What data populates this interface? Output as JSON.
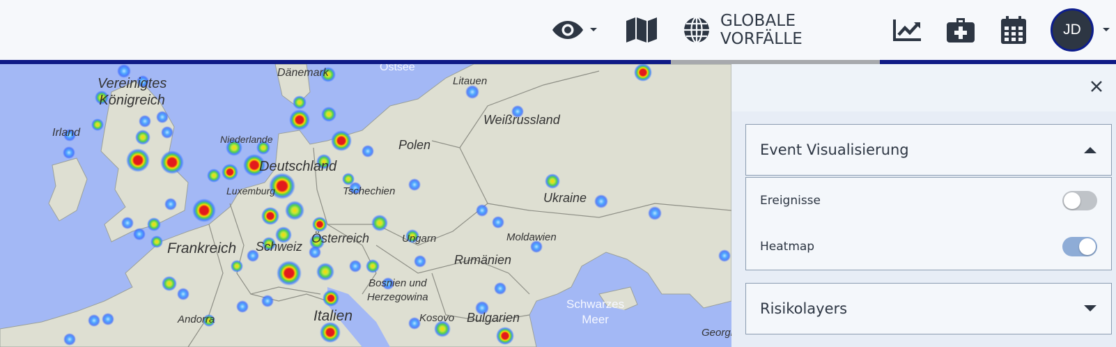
{
  "header": {
    "visibility_icon": "eye-icon",
    "map_icon": "map-icon",
    "global_icon": "globe-icon",
    "global_label": "GLOBALE VORFÄLLE",
    "trend_icon": "chart-line-icon",
    "firstaid_icon": "first-aid-kit-icon",
    "calendar_icon": "calendar-icon",
    "avatar_initials": "JD",
    "accent_color": "#0f1a86"
  },
  "map": {
    "labels": {
      "uk": "Vereinigtes\nKönigreich",
      "ireland": "Irland",
      "denmark": "Dänemark",
      "ostsee": "Ostsee",
      "litauen": "Litauen",
      "weissrussland": "Weißrussland",
      "polen": "Polen",
      "niederlande": "Niederlande",
      "deutschland": "Deutschland",
      "luxemburg": "Luxemburg",
      "tschechien": "Tschechien",
      "ukraine": "Ukraine",
      "frankreich": "Frankreich",
      "schweiz": "Schweiz",
      "oesterreich": "Österreich",
      "ungarn": "Ungarn",
      "moldawien": "Moldawien",
      "rumaenien": "Rumänien",
      "bosnien": "Bosnien und\nHerzegowina",
      "schwarzes_meer": "Schwarzes\nMeer",
      "andorra": "Andorra",
      "italien": "Italien",
      "kosovo": "Kosovo",
      "bulgarien": "Bulgarien",
      "georgien": "Georgien"
    }
  },
  "panel": {
    "close_icon": "close-icon",
    "event_section": {
      "title": "Event Visualisierung",
      "expanded": true,
      "toggles": [
        {
          "label": "Ereignisse",
          "on": false
        },
        {
          "label": "Heatmap",
          "on": true
        }
      ]
    },
    "risk_section": {
      "title": "Risikolayers",
      "expanded": false
    }
  }
}
